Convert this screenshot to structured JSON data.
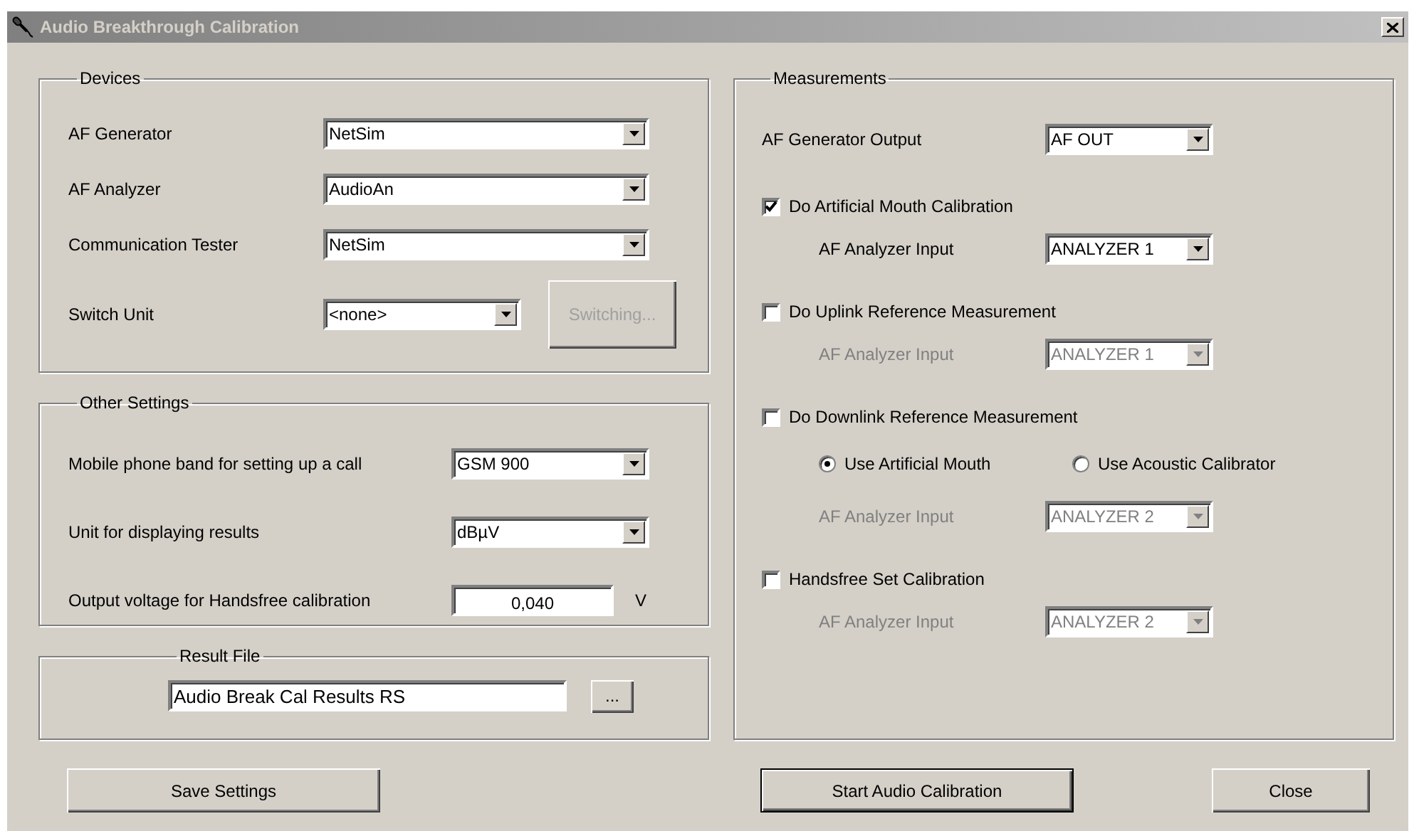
{
  "window": {
    "title": "Audio Breakthrough Calibration"
  },
  "devices": {
    "title": "Devices",
    "rows": [
      {
        "label": "AF Generator",
        "value": "NetSim"
      },
      {
        "label": "AF Analyzer",
        "value": "AudioAn"
      },
      {
        "label": "Communication Tester",
        "value": "NetSim"
      },
      {
        "label": "Switch Unit",
        "value": "<none>",
        "button": {
          "label": "Switching...",
          "disabled": true
        }
      }
    ]
  },
  "other_settings": {
    "title": "Other Settings",
    "rows": [
      {
        "kind": "dropdown",
        "label": "Mobile phone band for setting up a call",
        "value": "GSM 900"
      },
      {
        "kind": "dropdown",
        "label": "Unit for displaying results",
        "value": "dBµV"
      },
      {
        "kind": "number",
        "label": "Output voltage for Handsfree calibration",
        "value": "0,040",
        "unit": "V"
      }
    ]
  },
  "result_file": {
    "title": "Result File",
    "value": "Audio Break Cal Results RS",
    "browse": "..."
  },
  "measurements": {
    "title": "Measurements",
    "generator_output": {
      "label": "AF Generator Output",
      "value": "AF OUT"
    },
    "sections": [
      {
        "label": "Do Artificial Mouth Calibration",
        "checked": true,
        "input": {
          "label": "AF Analyzer Input",
          "value": "ANALYZER 1",
          "disabled": false
        }
      },
      {
        "label": "Do Uplink Reference Measurement",
        "checked": false,
        "input": {
          "label": "AF Analyzer Input",
          "value": "ANALYZER 1",
          "disabled": true
        }
      },
      {
        "label": "Do Downlink Reference Measurement",
        "checked": false,
        "radios": [
          {
            "label": "Use Artificial Mouth",
            "selected": true
          },
          {
            "label": "Use Acoustic Calibrator",
            "selected": false
          }
        ],
        "input": {
          "label": "AF Analyzer Input",
          "value": "ANALYZER 2",
          "disabled": true
        }
      },
      {
        "label": "Handsfree Set Calibration",
        "checked": false,
        "input": {
          "label": "AF Analyzer Input",
          "value": "ANALYZER 2",
          "disabled": true
        }
      }
    ]
  },
  "buttons": [
    {
      "label": "Save Settings",
      "default": false
    },
    {
      "label": "Start Audio Calibration",
      "default": true
    },
    {
      "label": "Close",
      "default": false
    }
  ]
}
